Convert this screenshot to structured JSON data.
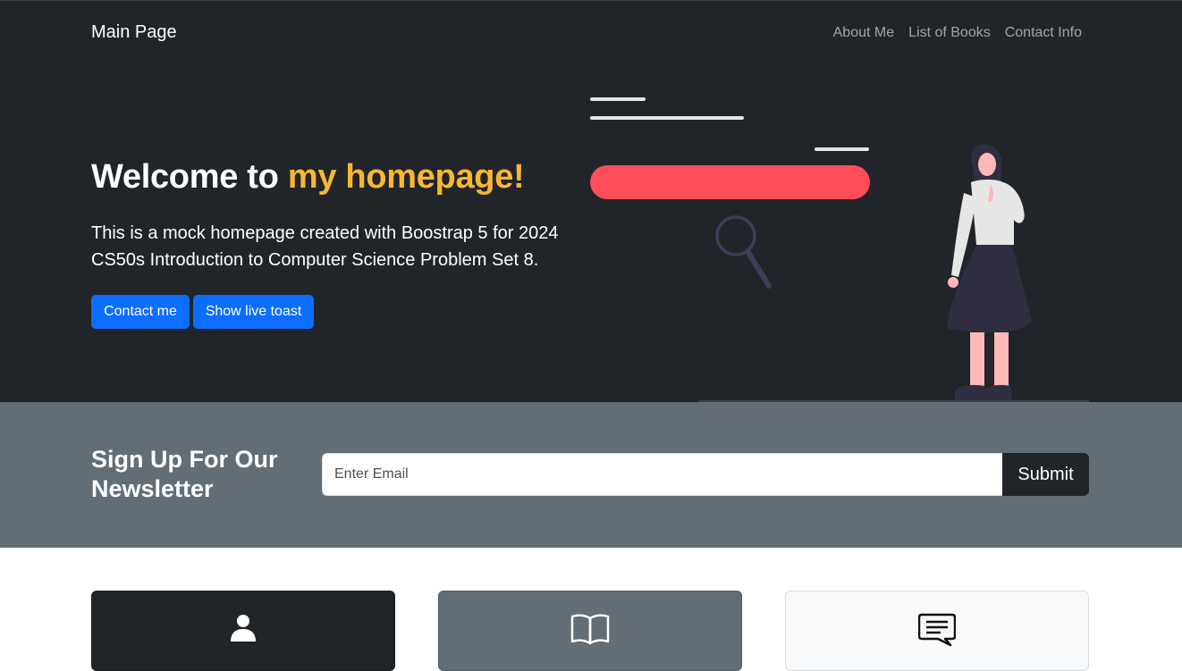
{
  "navbar": {
    "brand": "Main Page",
    "links": [
      "About Me",
      "List of Books",
      "Contact Info"
    ]
  },
  "hero": {
    "title_prefix": "Welcome to ",
    "title_accent": "my homepage!",
    "lead": "This is a mock homepage created with Boostrap 5 for 2024 CS50s Introduction to Computer Science Problem Set 8.",
    "buttons": {
      "contact": "Contact me",
      "toast": "Show live toast"
    }
  },
  "newsletter": {
    "title": "Sign Up For Our Newsletter",
    "email_placeholder": "Enter Email",
    "submit_label": "Submit"
  },
  "cards": [
    {
      "icon": "person-icon"
    },
    {
      "icon": "book-icon"
    },
    {
      "icon": "chat-icon"
    }
  ],
  "colors": {
    "dark": "#212529",
    "secondary": "#636d75",
    "light": "#f8f9fa",
    "primary": "#0d6efd",
    "accent": "#f8b733",
    "illustration_bar": "#ff4d5a"
  }
}
